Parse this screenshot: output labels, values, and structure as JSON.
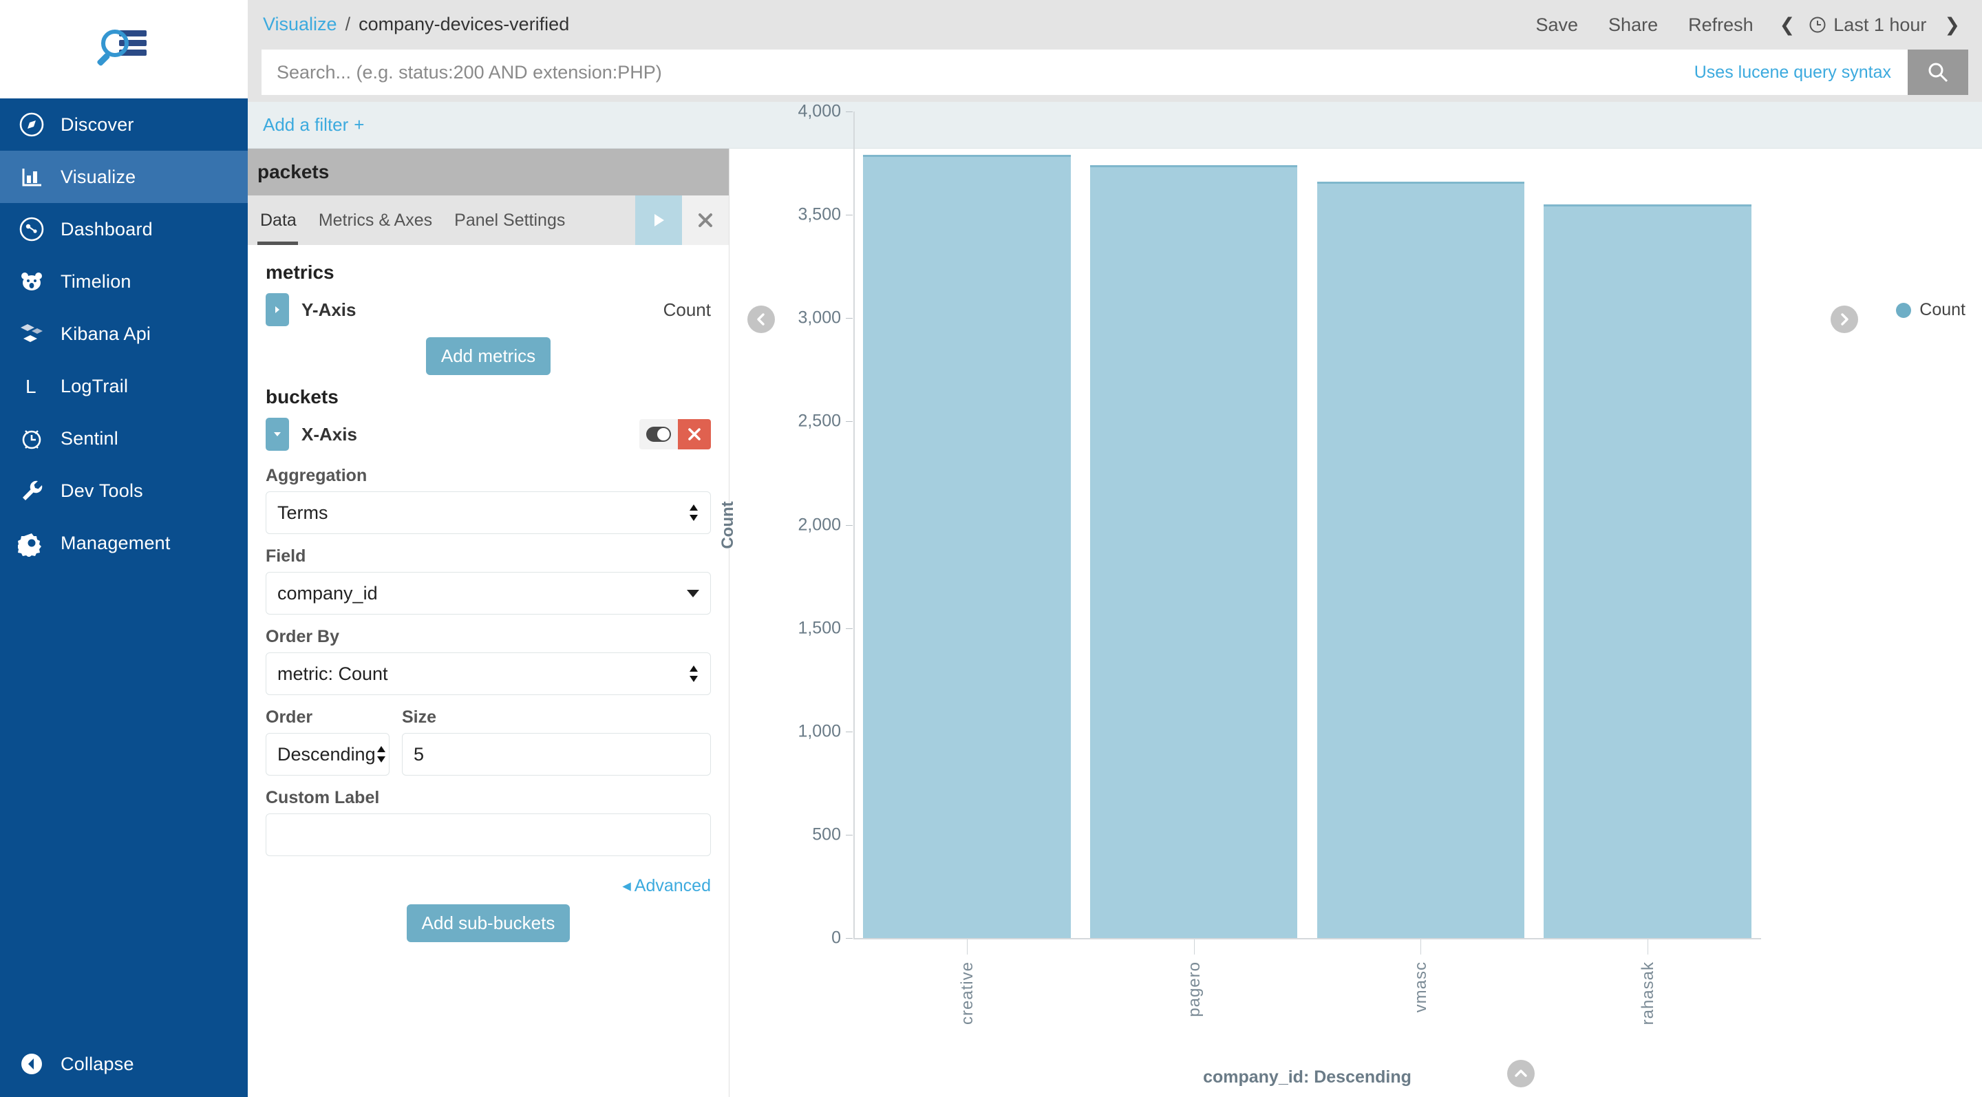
{
  "brand": {
    "logo_name": "kibana-logo"
  },
  "sidebar": {
    "items": [
      {
        "label": "Discover",
        "icon": "compass-icon",
        "active": false
      },
      {
        "label": "Visualize",
        "icon": "bar-chart-icon",
        "active": true
      },
      {
        "label": "Dashboard",
        "icon": "dashboard-icon",
        "active": false
      },
      {
        "label": "Timelion",
        "icon": "timelion-bear-icon",
        "active": false
      },
      {
        "label": "Kibana Api",
        "icon": "cubes-icon",
        "active": false
      },
      {
        "label": "LogTrail",
        "icon": "logtrail-l-icon",
        "active": false
      },
      {
        "label": "Sentinl",
        "icon": "alarm-clock-icon",
        "active": false
      },
      {
        "label": "Dev Tools",
        "icon": "wrench-icon",
        "active": false
      },
      {
        "label": "Management",
        "icon": "gear-icon",
        "active": false
      }
    ],
    "collapse_label": "Collapse"
  },
  "header": {
    "breadcrumb_root": "Visualize",
    "breadcrumb_separator": "/",
    "breadcrumb_current": "company-devices-verified",
    "save_label": "Save",
    "share_label": "Share",
    "refresh_label": "Refresh",
    "time_range": "Last 1 hour",
    "prev_arrow": "❮",
    "next_arrow": "❯",
    "clock_icon": "clock-icon"
  },
  "search": {
    "value": "",
    "placeholder": "Search... (e.g. status:200 AND extension:PHP)",
    "lucene_hint": "Uses lucene query syntax",
    "go_icon": "search-icon"
  },
  "filters": {
    "add_filter_label": "Add a filter",
    "add_glyph": "+"
  },
  "editor": {
    "title": "packets",
    "tabs": [
      {
        "label": "Data",
        "active": true
      },
      {
        "label": "Metrics & Axes",
        "active": false
      },
      {
        "label": "Panel Settings",
        "active": false
      }
    ],
    "apply_icon": "play-icon",
    "discard_icon": "close-icon",
    "metrics_heading": "metrics",
    "metric_rows": [
      {
        "name": "Y-Axis",
        "value": "Count",
        "collapsed": true
      }
    ],
    "add_metrics_label": "Add metrics",
    "buckets_heading": "buckets",
    "bucket_name": "X-Axis",
    "bucket_toggle_icon": "toggle-on-icon",
    "bucket_delete_icon": "close-icon",
    "fields": {
      "aggregation_label": "Aggregation",
      "aggregation_value": "Terms",
      "field_label": "Field",
      "field_value": "company_id",
      "order_by_label": "Order By",
      "order_by_value": "metric: Count",
      "order_label": "Order",
      "order_value": "Descending",
      "size_label": "Size",
      "size_value": "5",
      "custom_label_label": "Custom Label",
      "custom_label_value": "",
      "custom_label_placeholder": ""
    },
    "advanced_label": "Advanced",
    "advanced_caret": "◂",
    "add_subbuckets_label": "Add sub-buckets"
  },
  "vis": {
    "legend_label": "Count",
    "legend_color": "#6eaec6",
    "collapse_left_icon": "chevron-left-icon",
    "collapse_right_icon": "chevron-right-icon",
    "collapse_bottom_icon": "chevron-up-icon"
  },
  "chart_data": {
    "type": "bar",
    "title": "",
    "categories": [
      "creative",
      "pagero",
      "vmasc",
      "rahasak"
    ],
    "values": [
      3790,
      3740,
      3660,
      3550
    ],
    "series": [
      {
        "name": "Count",
        "values": [
          3790,
          3740,
          3660,
          3550
        ],
        "color": "#a5cede"
      }
    ],
    "xlabel": "company_id: Descending",
    "ylabel": "Count",
    "ylim": [
      0,
      4000
    ],
    "ytick_labels": [
      "4,000",
      "3,500",
      "3,000",
      "2,500",
      "2,000",
      "1,500",
      "1,000",
      "500",
      "0"
    ],
    "ytick_values": [
      4000,
      3500,
      3000,
      2500,
      2000,
      1500,
      1000,
      500,
      0
    ],
    "grid": false,
    "legend_position": "top-right",
    "legend_entries": [
      "Count"
    ],
    "bar_color": "#a5cede",
    "bar_border_color": "#7fb7cc"
  }
}
